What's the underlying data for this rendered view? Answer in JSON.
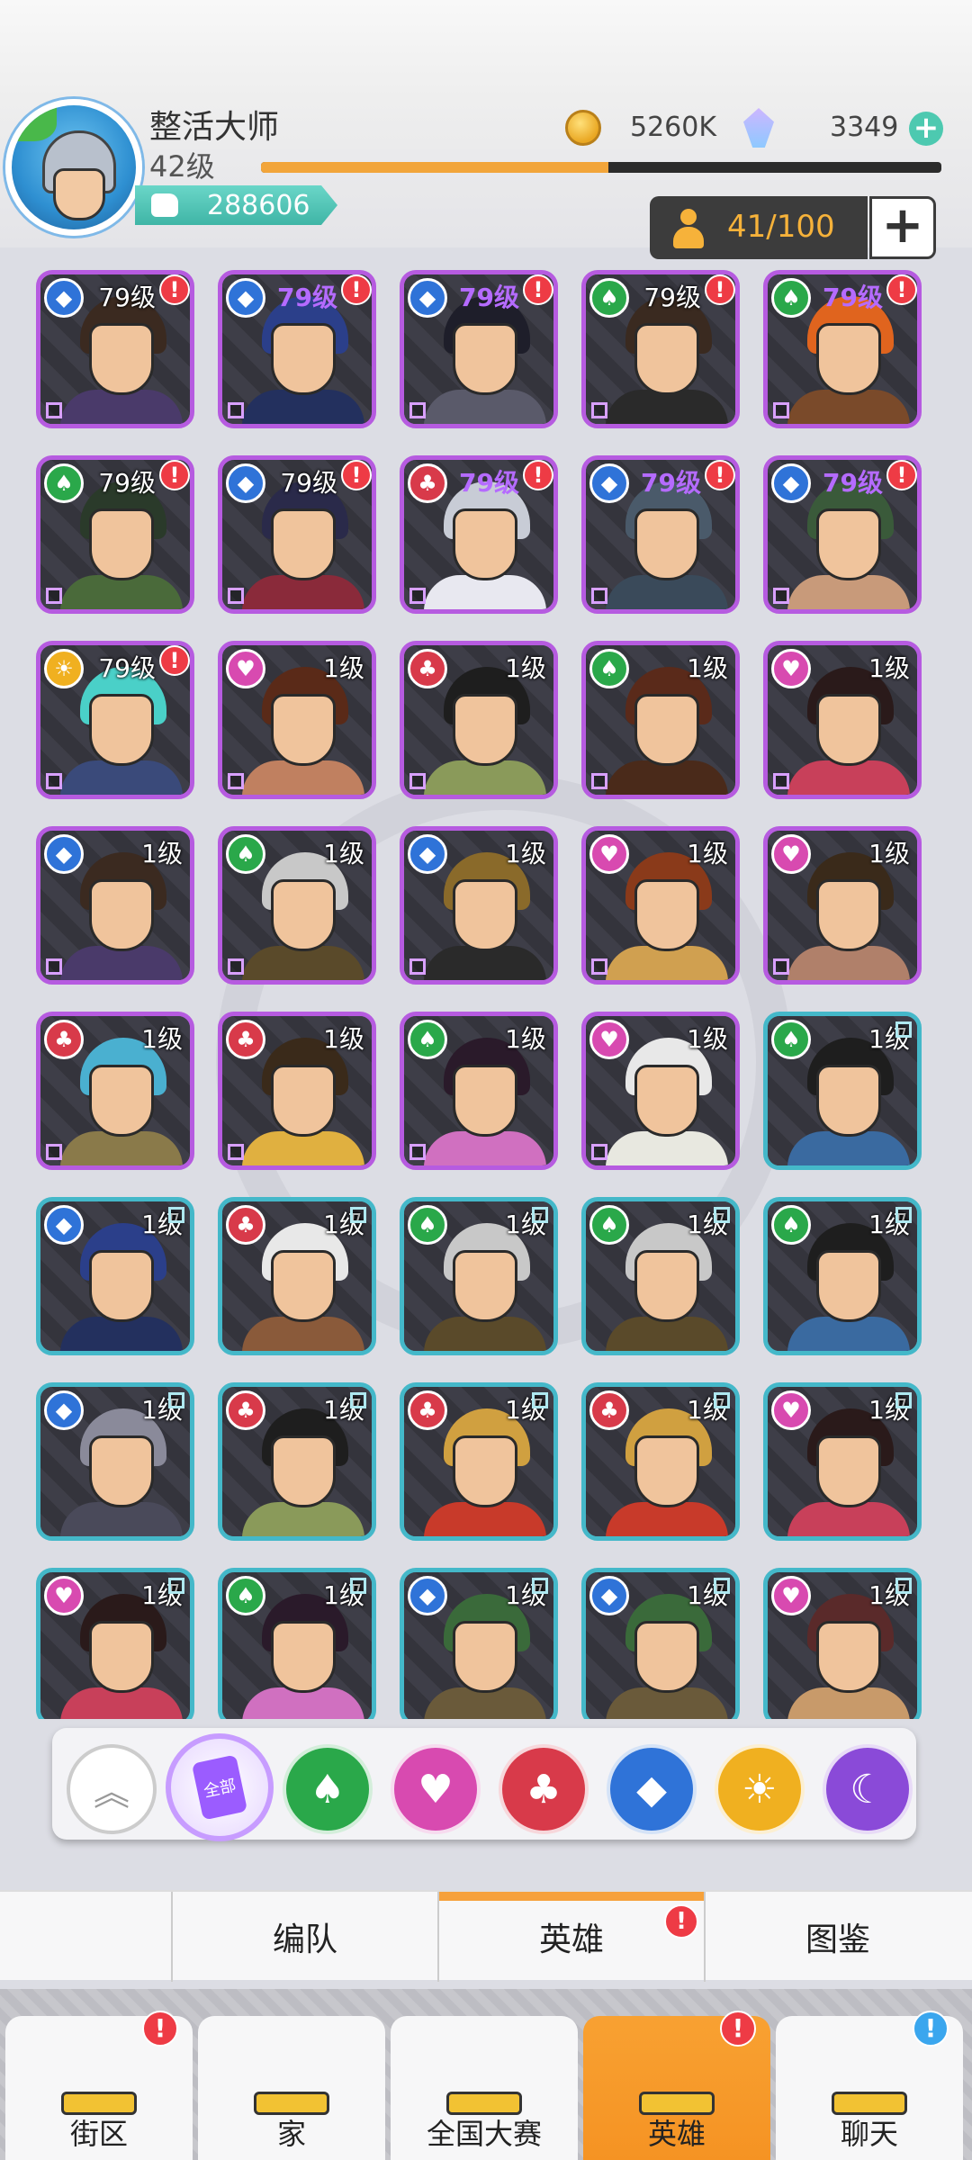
{
  "player": {
    "name": "整活大师",
    "level": "42级",
    "power": "288606",
    "exp_progress": 0.51
  },
  "currency": {
    "coins": "5260K",
    "gems": "3349",
    "gem_add": "+"
  },
  "roster": {
    "count": "41/100",
    "add": "+"
  },
  "heroes": [
    {
      "suit": "diamond",
      "suit_color": "#2f73d8",
      "level": "79级",
      "alert": "!",
      "rarity": "epic",
      "hair": "#3b2a20",
      "body": "#4a3a6a",
      "level_style": "white"
    },
    {
      "suit": "diamond",
      "suit_color": "#2f73d8",
      "level": "79级",
      "alert": "!",
      "rarity": "epic",
      "hair": "#2b3f8a",
      "body": "#23305e",
      "level_style": "purple"
    },
    {
      "suit": "diamond",
      "suit_color": "#2f73d8",
      "level": "79级",
      "alert": "!",
      "rarity": "epic",
      "hair": "#1e1e2a",
      "body": "#5a5a6a",
      "level_style": "purple"
    },
    {
      "suit": "spade",
      "suit_color": "#2aa84a",
      "level": "79级",
      "alert": "!",
      "rarity": "epic",
      "hair": "#3a2a20",
      "body": "#2a2a2a",
      "level_style": "white"
    },
    {
      "suit": "spade",
      "suit_color": "#2aa84a",
      "level": "79级",
      "alert": "!",
      "rarity": "epic",
      "hair": "#e0641e",
      "body": "#7a4a2a",
      "level_style": "purple"
    },
    {
      "suit": "spade",
      "suit_color": "#2aa84a",
      "level": "79级",
      "alert": "!",
      "rarity": "epic",
      "hair": "#2a3a2a",
      "body": "#4a6a3a",
      "level_style": "white"
    },
    {
      "suit": "diamond",
      "suit_color": "#2f73d8",
      "level": "79级",
      "alert": "!",
      "rarity": "epic",
      "hair": "#2a2a4a",
      "body": "#8a2a3a",
      "level_style": "white"
    },
    {
      "suit": "club",
      "suit_color": "#d83a4a",
      "level": "79级",
      "alert": "!",
      "rarity": "epic",
      "hair": "#c8ccd6",
      "body": "#e8e8f0",
      "level_style": "purple"
    },
    {
      "suit": "diamond",
      "suit_color": "#2f73d8",
      "level": "79级",
      "alert": "!",
      "rarity": "epic",
      "hair": "#4a5a6a",
      "body": "#3a4a5a",
      "level_style": "purple"
    },
    {
      "suit": "diamond",
      "suit_color": "#2f73d8",
      "level": "79级",
      "alert": "!",
      "rarity": "epic",
      "hair": "#3a5a3a",
      "body": "#c89a7a",
      "level_style": "purple"
    },
    {
      "suit": "sun",
      "suit_color": "#f0b020",
      "level": "79级",
      "alert": "!",
      "rarity": "epic",
      "hair": "#4ad0c8",
      "body": "#3a4a7a",
      "level_style": "white"
    },
    {
      "suit": "heart",
      "suit_color": "#d84ab0",
      "level": "1级",
      "alert": "",
      "rarity": "epic",
      "hair": "#5a2a18",
      "body": "#c08060",
      "level_style": "white"
    },
    {
      "suit": "club",
      "suit_color": "#d83a4a",
      "level": "1级",
      "alert": "",
      "rarity": "epic",
      "hair": "#1e1e1e",
      "body": "#8a9a5a",
      "level_style": "white"
    },
    {
      "suit": "spade",
      "suit_color": "#2aa84a",
      "level": "1级",
      "alert": "",
      "rarity": "epic",
      "hair": "#5a2a1a",
      "body": "#4a2a1a",
      "level_style": "white"
    },
    {
      "suit": "heart",
      "suit_color": "#d84ab0",
      "level": "1级",
      "alert": "",
      "rarity": "epic",
      "hair": "#2a1a1a",
      "body": "#c8405a",
      "level_style": "white"
    },
    {
      "suit": "diamond",
      "suit_color": "#2f73d8",
      "level": "1级",
      "alert": "",
      "rarity": "epic",
      "hair": "#3b2a20",
      "body": "#4a3a6a",
      "level_style": "white"
    },
    {
      "suit": "spade",
      "suit_color": "#2aa84a",
      "level": "1级",
      "alert": "",
      "rarity": "epic",
      "hair": "#c8c8c8",
      "body": "#5a4a2a",
      "level_style": "white"
    },
    {
      "suit": "diamond",
      "suit_color": "#2f73d8",
      "level": "1级",
      "alert": "",
      "rarity": "epic",
      "hair": "#8a6a2a",
      "body": "#2a2a2a",
      "level_style": "white"
    },
    {
      "suit": "heart",
      "suit_color": "#d84ab0",
      "level": "1级",
      "alert": "",
      "rarity": "epic",
      "hair": "#8a3a1a",
      "body": "#d0a050",
      "level_style": "white"
    },
    {
      "suit": "heart",
      "suit_color": "#d84ab0",
      "level": "1级",
      "alert": "",
      "rarity": "epic",
      "hair": "#3a2a1a",
      "body": "#b0806a",
      "level_style": "white"
    },
    {
      "suit": "club",
      "suit_color": "#d83a4a",
      "level": "1级",
      "alert": "",
      "rarity": "epic",
      "hair": "#4ab0d0",
      "body": "#8a7a4a",
      "level_style": "white"
    },
    {
      "suit": "club",
      "suit_color": "#d83a4a",
      "level": "1级",
      "alert": "",
      "rarity": "epic",
      "hair": "#3a2a1a",
      "body": "#e0b040",
      "level_style": "white"
    },
    {
      "suit": "spade",
      "suit_color": "#2aa84a",
      "level": "1级",
      "alert": "",
      "rarity": "epic",
      "hair": "#2a1a2a",
      "body": "#d070c0",
      "level_style": "white"
    },
    {
      "suit": "heart",
      "suit_color": "#d84ab0",
      "level": "1级",
      "alert": "",
      "rarity": "epic",
      "hair": "#e8e8e8",
      "body": "#e8e8e0",
      "level_style": "white"
    },
    {
      "suit": "spade",
      "suit_color": "#2aa84a",
      "level": "1级",
      "alert": "",
      "rarity": "rare",
      "hair": "#1e1e1e",
      "body": "#3a6aa0",
      "level_style": "white"
    },
    {
      "suit": "diamond",
      "suit_color": "#2f73d8",
      "level": "1级",
      "alert": "",
      "rarity": "rare",
      "hair": "#2b3f8a",
      "body": "#23305e",
      "level_style": "white"
    },
    {
      "suit": "club",
      "suit_color": "#d83a4a",
      "level": "1级",
      "alert": "",
      "rarity": "rare",
      "hair": "#e8e8e8",
      "body": "#8a5a3a",
      "level_style": "white"
    },
    {
      "suit": "spade",
      "suit_color": "#2aa84a",
      "level": "1级",
      "alert": "",
      "rarity": "rare",
      "hair": "#c8c8c8",
      "body": "#5a4a2a",
      "level_style": "white"
    },
    {
      "suit": "spade",
      "suit_color": "#2aa84a",
      "level": "1级",
      "alert": "",
      "rarity": "rare",
      "hair": "#c8c8c8",
      "body": "#5a4a2a",
      "level_style": "white"
    },
    {
      "suit": "spade",
      "suit_color": "#2aa84a",
      "level": "1级",
      "alert": "",
      "rarity": "rare",
      "hair": "#1e1e1e",
      "body": "#3a6aa0",
      "level_style": "white"
    },
    {
      "suit": "diamond",
      "suit_color": "#2f73d8",
      "level": "1级",
      "alert": "",
      "rarity": "rare",
      "hair": "#8a8a9a",
      "body": "#4a4a5a",
      "level_style": "white"
    },
    {
      "suit": "club",
      "suit_color": "#d83a4a",
      "level": "1级",
      "alert": "",
      "rarity": "rare",
      "hair": "#1e1e1e",
      "body": "#8a9a5a",
      "level_style": "white"
    },
    {
      "suit": "club",
      "suit_color": "#d83a4a",
      "level": "1级",
      "alert": "",
      "rarity": "rare",
      "hair": "#d0a040",
      "body": "#c83a2a",
      "level_style": "white"
    },
    {
      "suit": "club",
      "suit_color": "#d83a4a",
      "level": "1级",
      "alert": "",
      "rarity": "rare",
      "hair": "#d0a040",
      "body": "#c83a2a",
      "level_style": "white"
    },
    {
      "suit": "heart",
      "suit_color": "#d84ab0",
      "level": "1级",
      "alert": "",
      "rarity": "rare",
      "hair": "#2a1a1a",
      "body": "#c8405a",
      "level_style": "white"
    },
    {
      "suit": "heart",
      "suit_color": "#d84ab0",
      "level": "1级",
      "alert": "",
      "rarity": "rare",
      "hair": "#2a1a1a",
      "body": "#c8405a",
      "level_style": "white"
    },
    {
      "suit": "spade",
      "suit_color": "#2aa84a",
      "level": "1级",
      "alert": "",
      "rarity": "rare",
      "hair": "#2a1a2a",
      "body": "#d070c0",
      "level_style": "white"
    },
    {
      "suit": "diamond",
      "suit_color": "#2f73d8",
      "level": "1级",
      "alert": "",
      "rarity": "rare",
      "hair": "#3a6a3a",
      "body": "#6a5a3a",
      "level_style": "white"
    },
    {
      "suit": "diamond",
      "suit_color": "#2f73d8",
      "level": "1级",
      "alert": "",
      "rarity": "rare",
      "hair": "#3a6a3a",
      "body": "#6a5a3a",
      "level_style": "white"
    },
    {
      "suit": "heart",
      "suit_color": "#d84ab0",
      "level": "1级",
      "alert": "",
      "rarity": "rare",
      "hair": "#5a2a2a",
      "body": "#c89a6a",
      "level_style": "white"
    }
  ],
  "filters": [
    {
      "name": "collapse",
      "glyph": "︽",
      "color": "#ffffff"
    },
    {
      "name": "all",
      "glyph": "全部",
      "color": "#9b5cff"
    },
    {
      "name": "spade",
      "glyph": "♠",
      "color": "#2aa84a"
    },
    {
      "name": "heart",
      "glyph": "♥",
      "color": "#d84ab0"
    },
    {
      "name": "club",
      "glyph": "♣",
      "color": "#d83a4a"
    },
    {
      "name": "diamond",
      "glyph": "◆",
      "color": "#2f73d8"
    },
    {
      "name": "sun",
      "glyph": "☀",
      "color": "#f0b020"
    },
    {
      "name": "moon",
      "glyph": "☾",
      "color": "#8a4ad8"
    }
  ],
  "sub_tabs": {
    "formation": "编队",
    "heroes": "英雄",
    "heroes_alert": "!",
    "codex": "图鉴"
  },
  "nav": [
    {
      "label": "街区",
      "alert": "!",
      "alert_color": "red",
      "active": false,
      "icon": "street-sign-icon"
    },
    {
      "label": "家",
      "alert": "",
      "alert_color": "",
      "active": false,
      "icon": "house-icon"
    },
    {
      "label": "全国大赛",
      "alert": "",
      "alert_color": "",
      "active": false,
      "icon": "trophy-icon"
    },
    {
      "label": "英雄",
      "alert": "!",
      "alert_color": "red",
      "active": true,
      "icon": "hero-cards-icon"
    },
    {
      "label": "聊天",
      "alert": "!",
      "alert_color": "blue",
      "active": false,
      "icon": "chat-bubble-icon"
    }
  ]
}
